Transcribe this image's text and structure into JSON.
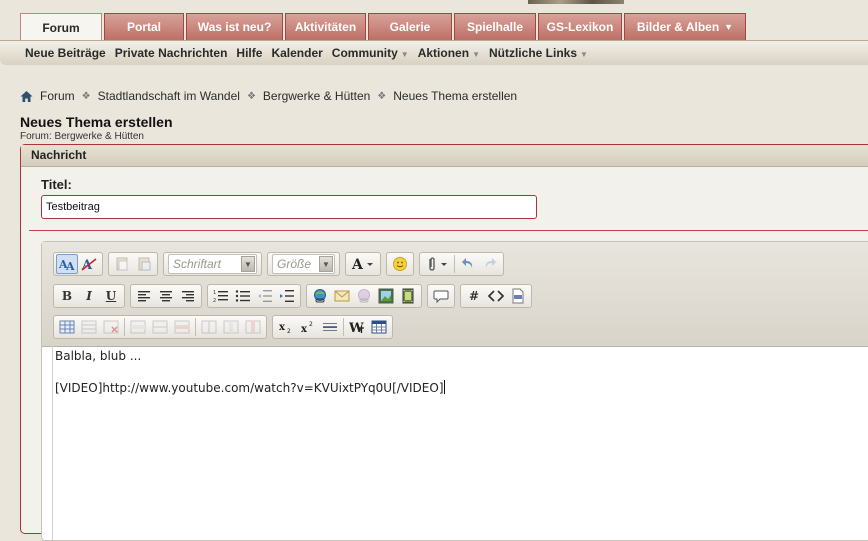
{
  "tabs": [
    {
      "label": "Forum",
      "active": true
    },
    {
      "label": "Portal"
    },
    {
      "label": "Was ist neu?"
    },
    {
      "label": "Aktivitäten"
    },
    {
      "label": "Galerie"
    },
    {
      "label": "Spielhalle"
    },
    {
      "label": "GS-Lexikon"
    },
    {
      "label": "Bilder & Alben",
      "dropdown": true
    }
  ],
  "subnav": [
    {
      "label": "Neue Beiträge"
    },
    {
      "label": "Private Nachrichten"
    },
    {
      "label": "Hilfe"
    },
    {
      "label": "Kalender"
    },
    {
      "label": "Community",
      "dropdown": true
    },
    {
      "label": "Aktionen",
      "dropdown": true
    },
    {
      "label": "Nützliche Links",
      "dropdown": true
    }
  ],
  "breadcrumb": [
    "Forum",
    "Stadtlandschaft im Wandel",
    "Bergwerke & Hütten",
    "Neues Thema erstellen"
  ],
  "page": {
    "title": "Neues Thema erstellen",
    "subtitle": "Forum: Bergwerke & Hütten"
  },
  "message": {
    "header": "Nachricht",
    "title_label": "Titel:",
    "title_value": "Testbeitrag"
  },
  "editor": {
    "font_select": "Schriftart",
    "size_select": "Größe",
    "content": [
      "Balbla, blub ...",
      "[VIDEO]http://www.youtube.com/watch?v=KVUixtPYq0U[/VIDEO]"
    ]
  },
  "colors": {
    "accent": "#a9343a",
    "tab": "#c77b71",
    "background": "#eae6dc"
  }
}
